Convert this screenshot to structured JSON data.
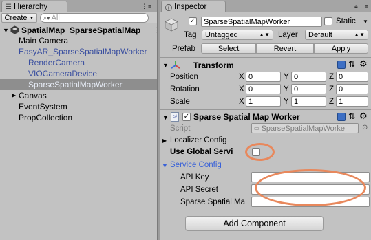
{
  "hierarchy": {
    "tab_label": "Hierarchy",
    "create_label": "Create",
    "search_placeholder": "All",
    "scene_name": "SpatialMap_SparseSpatialMap",
    "items": [
      {
        "label": "Main Camera",
        "color": "#000000"
      },
      {
        "label": "EasyAR_SparseSpatialMapWorker",
        "color": "#3a4fa0"
      },
      {
        "label": "RenderCamera",
        "color": "#3a4fa0"
      },
      {
        "label": "VIOCameraDevice",
        "color": "#3a4fa0"
      },
      {
        "label": "SparseSpatialMapWorker",
        "color": "#3a4fa0"
      },
      {
        "label": "Canvas",
        "color": "#000000"
      },
      {
        "label": "EventSystem",
        "color": "#000000"
      },
      {
        "label": "PropCollection",
        "color": "#000000"
      }
    ]
  },
  "inspector": {
    "tab_label": "Inspector",
    "object_name": "SparseSpatialMapWorker",
    "static_label": "Static",
    "tag_label": "Tag",
    "tag_value": "Untagged",
    "layer_label": "Layer",
    "layer_value": "Default",
    "prefab_label": "Prefab",
    "prefab_select": "Select",
    "prefab_revert": "Revert",
    "prefab_apply": "Apply",
    "transform": {
      "title": "Transform",
      "rows": [
        {
          "label": "Position",
          "x": "0",
          "y": "0",
          "z": "0"
        },
        {
          "label": "Rotation",
          "x": "0",
          "y": "0",
          "z": "0"
        },
        {
          "label": "Scale",
          "x": "1",
          "y": "1",
          "z": "1"
        }
      ],
      "axis_x": "X",
      "axis_y": "Y",
      "axis_z": "Z"
    },
    "worker": {
      "title": "Sparse Spatial Map Worker",
      "script_label": "Script",
      "script_value": "SparseSpatialMapWorke",
      "localizer_label": "Localizer Config",
      "use_global_label": "Use Global Servi",
      "service_config_label": "Service Config",
      "api_key_label": "API Key",
      "api_secret_label": "API Secret",
      "sparse_label": "Sparse Spatial Ma"
    },
    "add_component": "Add Component"
  },
  "colors": {
    "panel_bg": "#c2c2c2",
    "selection_bg": "#8e8e8e",
    "prefab_blue": "#3a4fa0",
    "service_config_blue": "#3a62d8",
    "highlight_ellipse": "#e8885c"
  }
}
